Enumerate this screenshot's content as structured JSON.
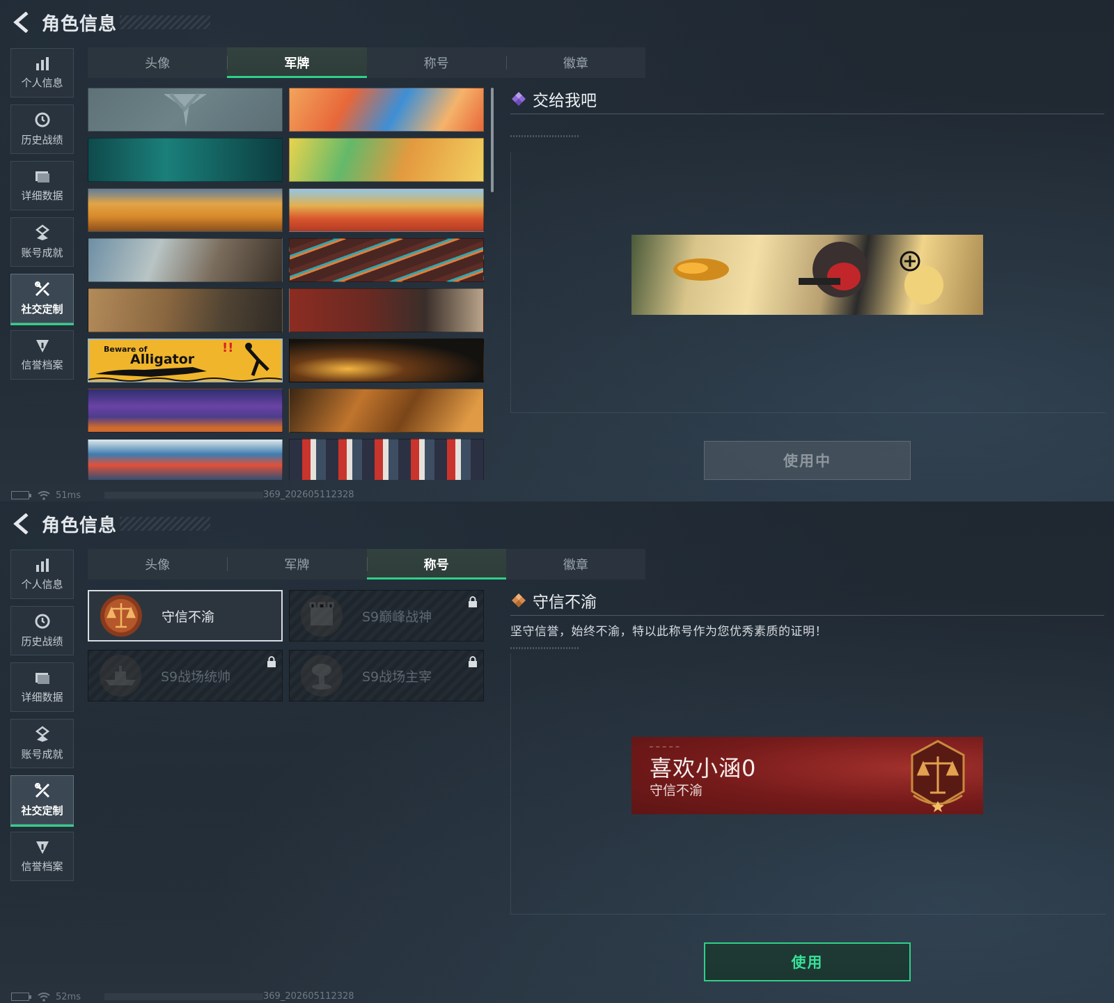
{
  "screen1": {
    "header": {
      "title": "角色信息"
    },
    "sidebar": [
      {
        "label": "个人信息",
        "icon": "bar-chart-icon"
      },
      {
        "label": "历史战绩",
        "icon": "clock-history-icon"
      },
      {
        "label": "详细数据",
        "icon": "folder-icon"
      },
      {
        "label": "账号成就",
        "icon": "achievement-icon"
      },
      {
        "label": "社交定制",
        "icon": "tools-icon",
        "active": true
      },
      {
        "label": "信誉档案",
        "icon": "reputation-shield-icon"
      }
    ],
    "tabs": [
      {
        "label": "头像"
      },
      {
        "label": "军牌",
        "active": true
      },
      {
        "label": "称号"
      },
      {
        "label": "徽章"
      }
    ],
    "card_text": {
      "line1": "Beware of",
      "line2": "Alligator",
      "exclaim": "!!"
    },
    "detail": {
      "title": "交给我吧"
    },
    "action_button": "使用中",
    "status": {
      "ping": "51ms",
      "build": "369_202605112328"
    }
  },
  "screen2": {
    "header": {
      "title": "角色信息"
    },
    "sidebar": [
      {
        "label": "个人信息",
        "icon": "bar-chart-icon"
      },
      {
        "label": "历史战绩",
        "icon": "clock-history-icon"
      },
      {
        "label": "详细数据",
        "icon": "folder-icon"
      },
      {
        "label": "账号成就",
        "icon": "achievement-icon"
      },
      {
        "label": "社交定制",
        "icon": "tools-icon",
        "active": true
      },
      {
        "label": "信誉档案",
        "icon": "reputation-shield-icon"
      }
    ],
    "tabs": [
      {
        "label": "头像"
      },
      {
        "label": "军牌"
      },
      {
        "label": "称号",
        "active": true
      },
      {
        "label": "徽章"
      }
    ],
    "titles": [
      {
        "name": "守信不渝",
        "locked": false,
        "icon": "scales-badge-icon"
      },
      {
        "name": "S9巅峰战神",
        "locked": true,
        "icon": "fortress-badge-icon"
      },
      {
        "name": "S9战场统帅",
        "locked": true,
        "icon": "warship-badge-icon"
      },
      {
        "name": "S9战场主宰",
        "locked": true,
        "icon": "mushroom-cloud-badge-icon"
      }
    ],
    "detail": {
      "title": "守信不渝",
      "description": "坚守信誉，始终不渝，特以此称号作为您优秀素质的证明！"
    },
    "nameplate": {
      "player_name": "喜欢小涵0",
      "title": "守信不渝"
    },
    "action_button": "使用",
    "status": {
      "ping": "52ms",
      "build": "369_202605112328"
    }
  },
  "colors": {
    "accent_green": "#2fd08a",
    "tab_bg": "#2d363f",
    "detail_diamond_1": "#8f6bd9",
    "detail_diamond_2": "#d98a4b",
    "nameplate_red": "#8c2522"
  }
}
